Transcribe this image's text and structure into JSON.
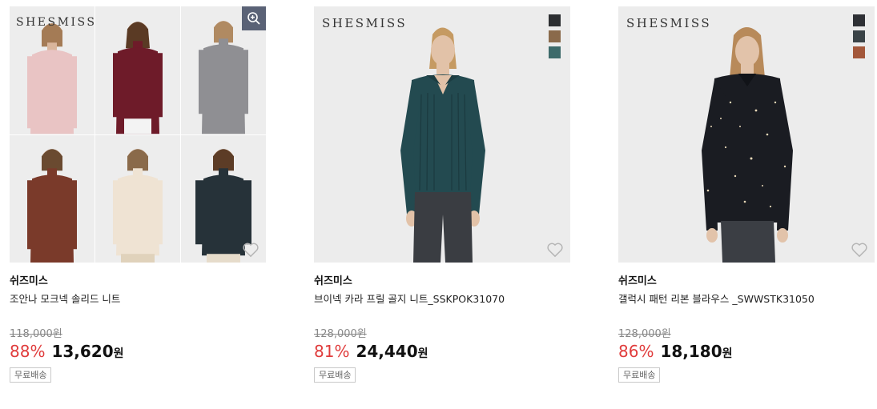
{
  "products": [
    {
      "logo": "SHESMISS",
      "brand": "쉬즈미스",
      "name": "조안나 모크넥 솔리드 니트",
      "original_price": "118,000원",
      "discount": "88%",
      "sale_price": "13,620",
      "currency": "원",
      "shipping_tag": "무료배송",
      "collage_colors": [
        "#e9c4c4",
        "#6e1b29",
        "#8f8f93",
        "#7a3a2a",
        "#efe3d3",
        "#263239"
      ],
      "swatches": []
    },
    {
      "logo": "SHESMISS",
      "brand": "쉬즈미스",
      "name": "브이넥 카라 프릴 골지 니트_SSKPOK31070",
      "original_price": "128,000원",
      "discount": "81%",
      "sale_price": "24,440",
      "currency": "원",
      "shipping_tag": "무료배송",
      "garment_color": "#234a50",
      "swatches": [
        "#2c2e31",
        "#8a6a4b",
        "#3d6a6a"
      ]
    },
    {
      "logo": "SHESMISS",
      "brand": "쉬즈미스",
      "name": "갤럭시 패턴 리본 블라우스 _SWWSTK31050",
      "original_price": "128,000원",
      "discount": "86%",
      "sale_price": "18,180",
      "currency": "원",
      "shipping_tag": "무료배송",
      "garment_color": "#1a1c22",
      "swatches": [
        "#2e3035",
        "#3a4347",
        "#a3573a"
      ]
    }
  ],
  "icons": {
    "zoom": "zoom-in-icon",
    "wishlist": "heart-outline-icon"
  }
}
